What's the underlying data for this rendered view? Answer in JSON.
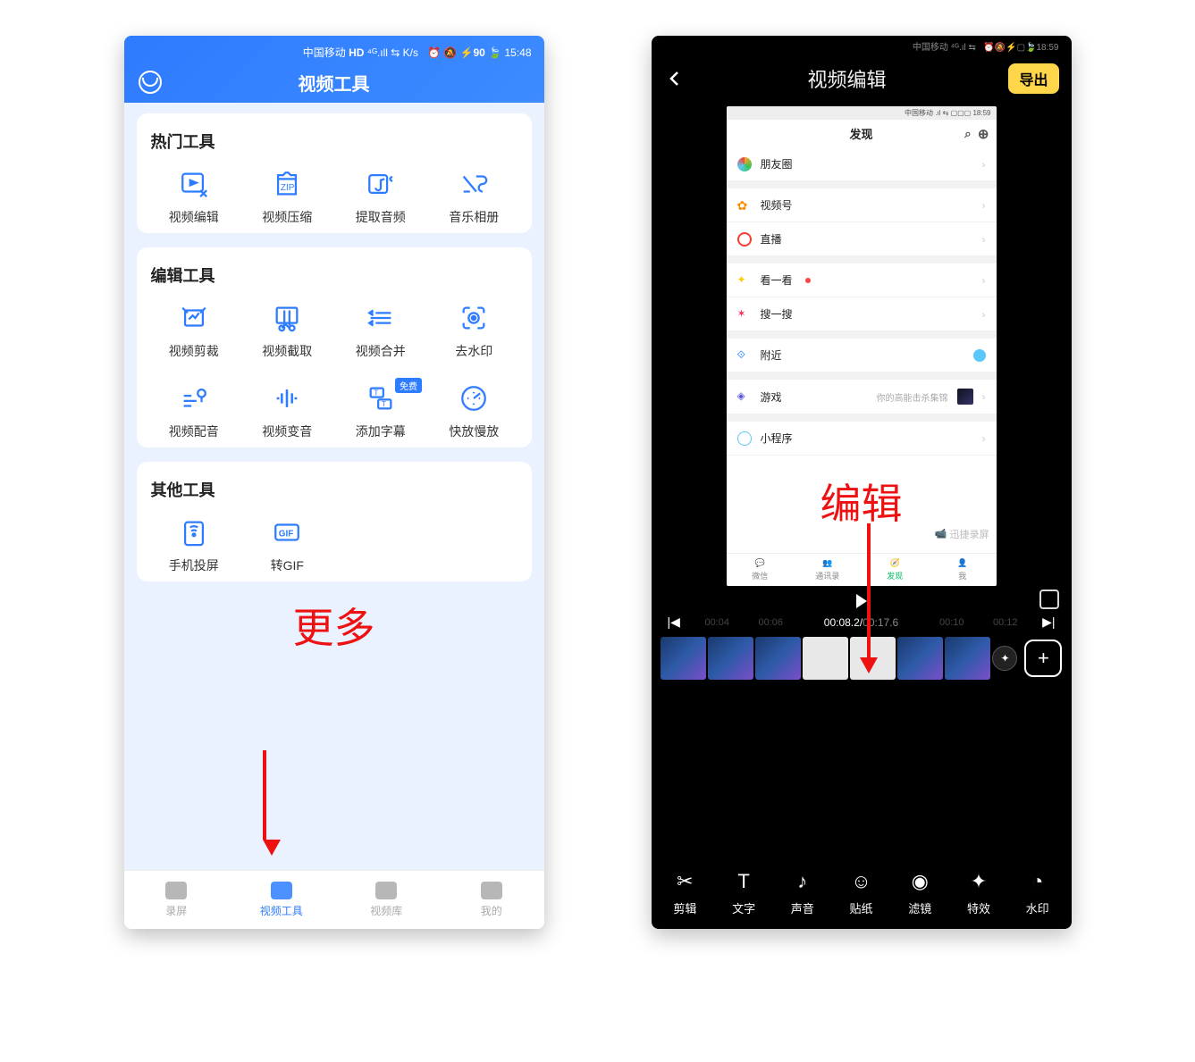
{
  "left": {
    "status": {
      "carrier": "中国移动",
      "net": "K/s",
      "battery": "90",
      "time": "15:48"
    },
    "title": "视频工具",
    "sections": [
      {
        "title": "热门工具",
        "items": [
          {
            "name": "video-edit",
            "label": "视频编辑"
          },
          {
            "name": "video-compress",
            "label": "视频压缩"
          },
          {
            "name": "extract-audio",
            "label": "提取音频"
          },
          {
            "name": "music-album",
            "label": "音乐相册"
          }
        ]
      },
      {
        "title": "编辑工具",
        "items": [
          {
            "name": "video-crop",
            "label": "视频剪裁"
          },
          {
            "name": "video-capture",
            "label": "视频截取"
          },
          {
            "name": "video-merge",
            "label": "视频合并"
          },
          {
            "name": "remove-watermark",
            "label": "去水印"
          },
          {
            "name": "video-dub",
            "label": "视频配音"
          },
          {
            "name": "voice-change",
            "label": "视频变音"
          },
          {
            "name": "add-subtitle",
            "label": "添加字幕",
            "badge": "免费"
          },
          {
            "name": "speed",
            "label": "快放慢放"
          }
        ]
      },
      {
        "title": "其他工具",
        "items": [
          {
            "name": "cast",
            "label": "手机投屏"
          },
          {
            "name": "togif",
            "label": "转GIF"
          }
        ]
      }
    ],
    "annotation": "更多",
    "tabs": [
      {
        "name": "tab-record",
        "label": "录屏"
      },
      {
        "name": "tab-tools",
        "label": "视频工具",
        "active": true
      },
      {
        "name": "tab-library",
        "label": "视频库"
      },
      {
        "name": "tab-mine",
        "label": "我的"
      }
    ]
  },
  "right": {
    "status": {
      "carrier": "中国移动",
      "battery": "",
      "time": "18:59"
    },
    "title": "视频编辑",
    "export": "导出",
    "preview": {
      "header": "发现",
      "items": [
        {
          "icon": "#f5a623",
          "label": "朋友圈"
        },
        {
          "icon": "#ff8a00",
          "label": "视频号"
        },
        {
          "icon": "#ff3b30",
          "label": "直播"
        },
        {
          "icon": "#ffcc00",
          "label": "看一看",
          "dot": true
        },
        {
          "icon": "#ff2d55",
          "label": "搜一搜"
        },
        {
          "icon": "#007aff",
          "label": "附近"
        },
        {
          "icon": "#5856d6",
          "label": "游戏",
          "sub": "你的高能击杀集锦"
        },
        {
          "icon": "#5ac8fa",
          "label": "小程序"
        }
      ],
      "tabs": [
        {
          "label": "微信"
        },
        {
          "label": "通讯录"
        },
        {
          "label": "发现",
          "on": true
        },
        {
          "label": "我"
        }
      ],
      "watermark": "迅捷录屏"
    },
    "annotation": "编辑",
    "time": {
      "cur": "00:08.2",
      "total": "00:17.6",
      "marks": [
        "00:04",
        "00:06",
        "00:10",
        "00:12"
      ]
    },
    "tools": [
      {
        "name": "cut",
        "label": "剪辑",
        "glyph": "✂"
      },
      {
        "name": "text",
        "label": "文字",
        "glyph": "T"
      },
      {
        "name": "sound",
        "label": "声音",
        "glyph": "♪"
      },
      {
        "name": "sticker",
        "label": "贴纸",
        "glyph": "☺"
      },
      {
        "name": "filter",
        "label": "滤镜",
        "glyph": "◉"
      },
      {
        "name": "effect",
        "label": "特效",
        "glyph": "✦"
      },
      {
        "name": "watermark",
        "label": "水印",
        "glyph": "◔"
      }
    ]
  }
}
